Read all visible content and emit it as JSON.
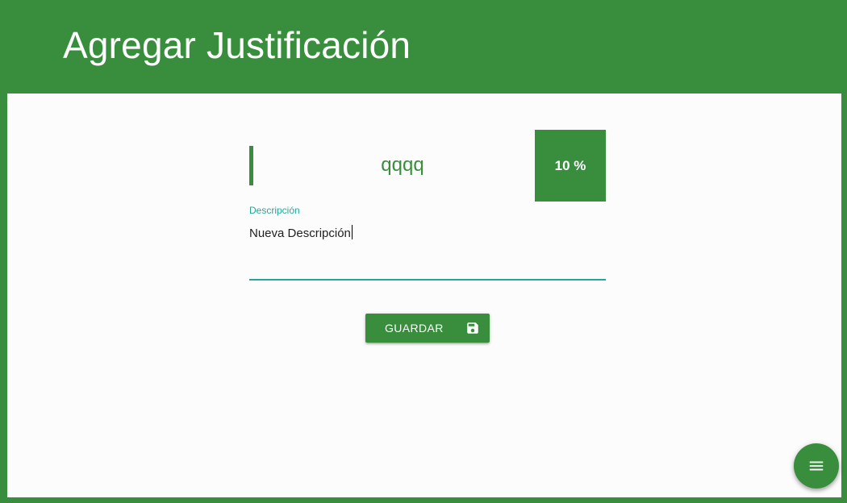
{
  "header": {
    "title": "Agregar Justificación"
  },
  "item": {
    "name": "qqqq",
    "percent_label": "10 %"
  },
  "description_field": {
    "label": "Descripción",
    "value": "Nueva Descripción"
  },
  "actions": {
    "save_label": "GUARDAR",
    "save_icon": "floppy-disk-icon",
    "fab_icon": "menu-icon"
  },
  "colors": {
    "primary": "#388e3c",
    "accent": "#26a69a",
    "background": "#fcfcfc"
  }
}
